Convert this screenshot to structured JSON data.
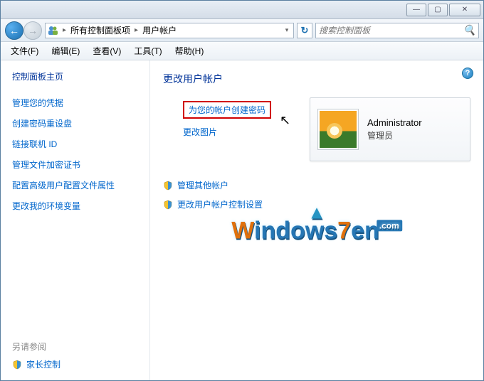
{
  "titlebar": {
    "min": "—",
    "max": "▢",
    "close": "✕"
  },
  "nav": {
    "back": "←",
    "fwd": "→"
  },
  "address": {
    "seg1": "所有控制面板项",
    "seg2": "用户帐户",
    "arrow": "▸",
    "drop": "▾"
  },
  "refresh": "↻",
  "search": {
    "placeholder": "搜索控制面板",
    "icon": "🔍"
  },
  "menu": {
    "file": "文件(F)",
    "edit": "编辑(E)",
    "view": "查看(V)",
    "tools": "工具(T)",
    "help": "帮助(H)"
  },
  "sidebar": {
    "home": "控制面板主页",
    "links": [
      "管理您的凭据",
      "创建密码重设盘",
      "链接联机 ID",
      "管理文件加密证书",
      "配置高级用户配置文件属性",
      "更改我的环境变量"
    ],
    "seealso": "另请参阅",
    "parental": "家长控制"
  },
  "main": {
    "heading": "更改用户帐户",
    "createpw": "为您的帐户创建密码",
    "changepic": "更改图片",
    "manageother": "管理其他帐户",
    "changeuac": "更改用户帐户控制设置"
  },
  "user": {
    "name": "Administrator",
    "role": "管理员"
  },
  "help": "?",
  "watermark": {
    "text1": "W",
    "text2": "indows",
    "text3": "7",
    "text4": "en",
    "dotcom": ".com",
    "roof": "✦"
  }
}
